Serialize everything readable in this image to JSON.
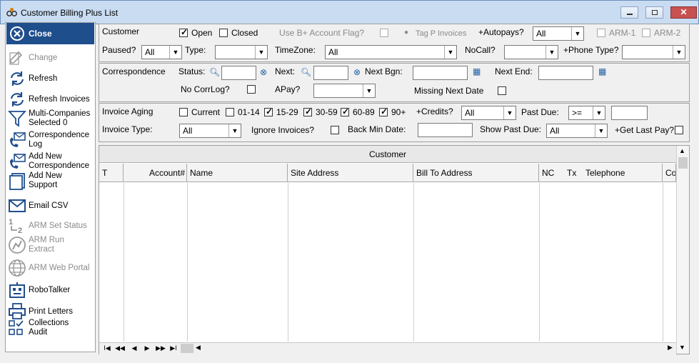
{
  "window": {
    "title": "Customer Billing Plus List",
    "close_glyph": "✕"
  },
  "sidebar": {
    "close": "Close",
    "items": [
      {
        "label": "Change",
        "icon": "edit-icon",
        "disabled": true
      },
      {
        "label": "Refresh",
        "icon": "refresh-icon"
      },
      {
        "label": "Refresh Invoices",
        "icon": "refresh-invoices-icon"
      },
      {
        "label": "Multi-Companies\nSelected 0",
        "icon": "filter-icon"
      },
      {
        "label": "Correspondence\nLog",
        "icon": "phone-mail-icon"
      },
      {
        "label": "Add New\nCorrespondence",
        "icon": "phone-mail-add-icon"
      },
      {
        "label": "Add New\nSupport",
        "icon": "support-icon"
      },
      {
        "label": "Email CSV",
        "icon": "email-icon"
      },
      {
        "label": "ARM Set Status",
        "icon": "set-status-icon",
        "disabled": true
      },
      {
        "label": "ARM Run\nExtract",
        "icon": "run-extract-icon",
        "disabled": true
      },
      {
        "label": "ARM Web Portal",
        "icon": "globe-icon",
        "disabled": true
      },
      {
        "label": "RoboTalker",
        "icon": "robotalker-icon"
      },
      {
        "label": "Print Letters",
        "icon": "printer-icon"
      },
      {
        "label": "Collections\nAudit",
        "icon": "collections-audit-icon"
      }
    ]
  },
  "customer": {
    "section": "Customer",
    "open": "Open",
    "closed": "Closed",
    "use_flag": "Use B+ Account Flag?",
    "tag_p": "Tag P Invoices",
    "autopays": "+Autopays?",
    "autopays_value": "All",
    "arm1": "ARM-1",
    "arm2": "ARM-2",
    "paused": "Paused?",
    "paused_value": "All",
    "type": "Type:",
    "type_value": "",
    "timezone": "TimeZone:",
    "timezone_value": "All",
    "nocall": "NoCall?",
    "nocall_value": "",
    "phone_type": "+Phone Type?",
    "phone_type_value": ""
  },
  "correspondence": {
    "section": "Correspondence",
    "status": "Status:",
    "next": "Next:",
    "next_bgn": "Next Bgn:",
    "next_end": "Next End:",
    "no_corrlog": "No CorrLog?",
    "apay": "APay?",
    "missing_next": "Missing Next Date"
  },
  "invoice": {
    "section": "Invoice Aging",
    "aging": [
      "Current",
      "01-14",
      "15-29",
      "30-59",
      "60-89",
      "90+"
    ],
    "credits": "+Credits?",
    "credits_value": "All",
    "past_due": "Past Due:",
    "past_due_op": ">=",
    "invoice_type": "Invoice Type:",
    "invoice_type_value": "All",
    "ignore": "Ignore Invoices?",
    "back_min": "Back Min Date:",
    "show_past_due": "Show Past Due:",
    "show_past_due_value": "All",
    "get_last_pay": "+Get Last Pay?"
  },
  "grid": {
    "caption": "Customer",
    "columns": [
      "T",
      "Account#",
      "Name",
      "Site Address",
      "Bill To Address",
      "NC",
      "Tx",
      "Telephone",
      "Co"
    ]
  },
  "nav": [
    "I◀",
    "◀◀",
    "◀",
    "▶",
    "▶▶",
    "▶I"
  ]
}
